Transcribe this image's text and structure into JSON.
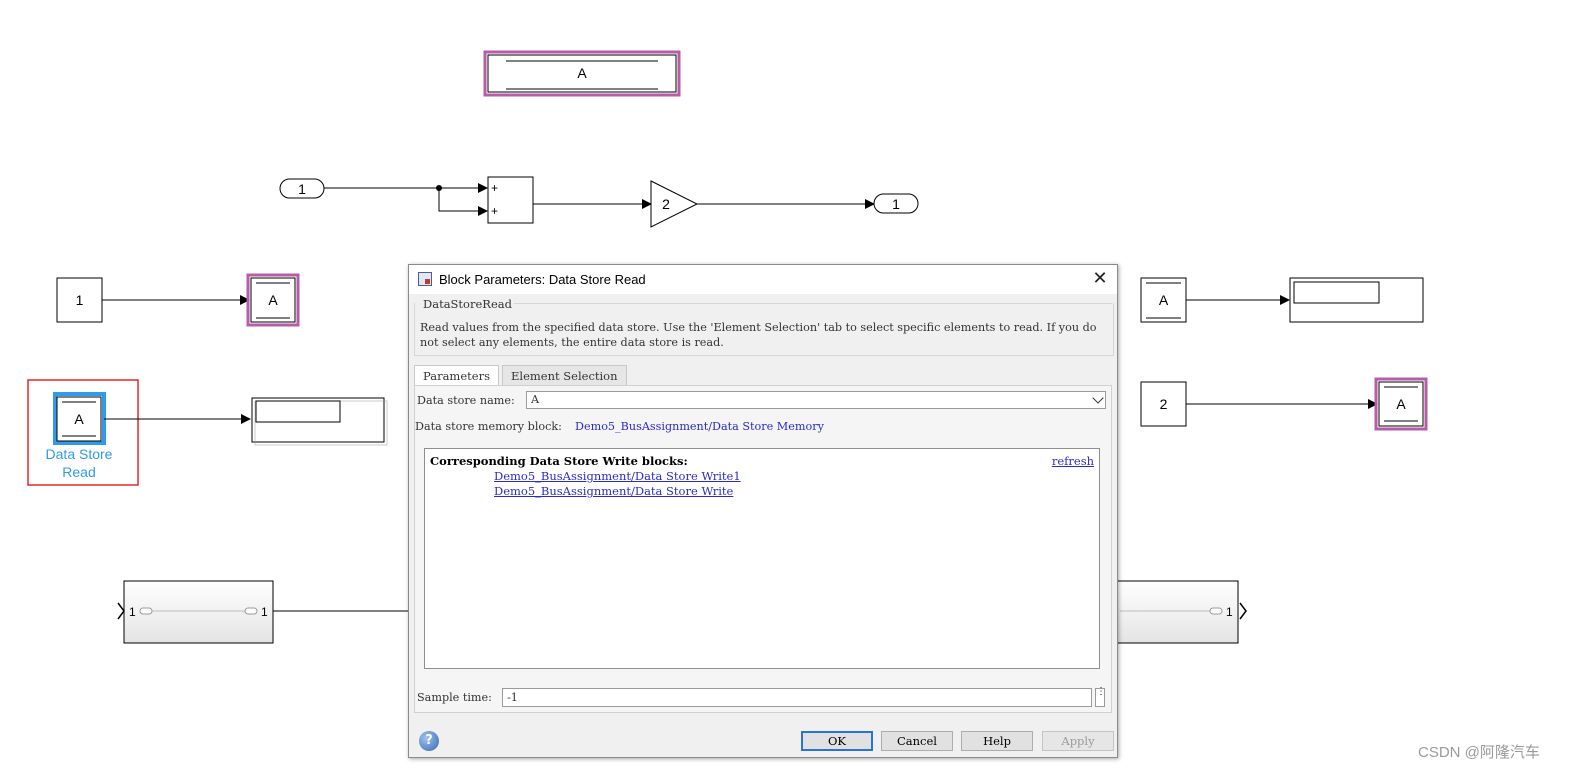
{
  "canvas": {
    "ds_memory_label": "A",
    "inport_top": "1",
    "outport_top": "1",
    "sum_sign_1": "+",
    "sum_sign_2": "+",
    "gain_value": "2",
    "const_left": "1",
    "ds_write_left": "A",
    "ds_read_selected": "A",
    "ds_read_caption_1": "Data Store",
    "ds_read_caption_2": "Read",
    "bus_left_in": "1",
    "bus_left_out": "1",
    "ds_read_right": "A",
    "const_right": "2",
    "ds_write_right": "A",
    "bus_right_out": "1",
    "selected_color": "#2f9bea",
    "highlight_color": "#b65ca9",
    "selection_box_color": "#e3272d"
  },
  "dialog": {
    "title": "Block Parameters: Data Store Read",
    "group_label": "DataStoreRead",
    "description": "Read values from the specified data store. Use the 'Element Selection' tab to select specific elements to read. If you do not select any elements, the entire data store is read.",
    "tabs": [
      {
        "label": "Parameters"
      },
      {
        "label": "Element Selection"
      }
    ],
    "store_name_label": "Data store name:",
    "store_name_value": "A",
    "memory_block_label": "Data store memory block:",
    "memory_block_link": "Demo5_BusAssignment/Data Store Memory",
    "write_blocks_header": "Corresponding Data Store Write blocks:",
    "refresh_label": "refresh",
    "write_blocks": [
      "Demo5_BusAssignment/Data Store Write1",
      "Demo5_BusAssignment/Data Store Write"
    ],
    "sample_time_label": "Sample time:",
    "sample_time_value": "-1",
    "buttons": {
      "ok": "OK",
      "cancel": "Cancel",
      "help": "Help",
      "apply": "Apply"
    },
    "help_icon_glyph": "?",
    "close_glyph": "✕",
    "menu_glyph": "⋮"
  },
  "watermark": "CSDN @阿隆汽车"
}
